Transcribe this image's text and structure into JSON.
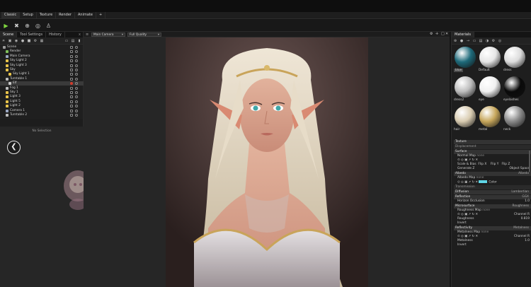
{
  "menubar": {
    "tabs": [
      "Classic",
      "Setup",
      "Texture",
      "Render",
      "Animate",
      "+"
    ]
  },
  "toolbar": {
    "tools": [
      "arrow-select-icon",
      "transform-icon",
      "globe-icon",
      "target-icon",
      "person-icon"
    ]
  },
  "left_panel": {
    "tabs": [
      "Scene",
      "Tool Settings",
      "History"
    ],
    "close": "x",
    "tree": [
      {
        "label": "Scene",
        "indent": 0,
        "color": "#9a9a9a"
      },
      {
        "label": "Render",
        "indent": 1,
        "color": "#7fc15a"
      },
      {
        "label": "Main Camera",
        "indent": 1,
        "color": "#9aa7c2"
      },
      {
        "label": "Sky Light 2",
        "indent": 1,
        "color": "#e8c34a"
      },
      {
        "label": "Sky Light 3",
        "indent": 1,
        "color": "#e8c34a"
      },
      {
        "label": "Sky",
        "indent": 1,
        "color": "#e8c34a"
      },
      {
        "label": "Sky Light 1",
        "indent": 2,
        "color": "#e8c34a"
      },
      {
        "label": "Turntable 1",
        "indent": 1,
        "color": "#bdbdbd"
      },
      {
        "label": "Elf",
        "indent": 2,
        "color": "#c9c9c9"
      },
      {
        "label": "Fog 1",
        "indent": 1,
        "color": "#bdbdbd"
      },
      {
        "label": "Sky 1",
        "indent": 1,
        "color": "#e8c34a"
      },
      {
        "label": "Light 3",
        "indent": 1,
        "color": "#e8c34a"
      },
      {
        "label": "Light 5",
        "indent": 1,
        "color": "#e8c34a"
      },
      {
        "label": "Light 2",
        "indent": 1,
        "color": "#e8c34a"
      },
      {
        "label": "Camera 1",
        "indent": 1,
        "color": "#9aa7c2"
      },
      {
        "label": "Turntable 2",
        "indent": 1,
        "color": "#bdbdbd"
      }
    ],
    "no_selection": "No Selection"
  },
  "viewport": {
    "camera_select": "Main Camera",
    "quality_select": "Full Quality"
  },
  "materials": {
    "title": "Materials",
    "items": [
      {
        "name": "blue",
        "color": "#1e6a7a",
        "selected": true
      },
      {
        "name": "Default",
        "color": "#e6e6e6",
        "selected": false
      },
      {
        "name": "dress",
        "color": "#dcdcdc",
        "selected": false
      },
      {
        "name": "dress2",
        "color": "#bdbdbd",
        "selected": false
      },
      {
        "name": "eye",
        "color": "#f0f0f0",
        "selected": false
      },
      {
        "name": "eyelashes",
        "color": "#0a0a0a",
        "selected": false
      },
      {
        "name": "hair",
        "color": "#d9ccb1",
        "selected": false
      },
      {
        "name": "metal",
        "color": "#c7a75c",
        "selected": false
      },
      {
        "name": "neck",
        "color": "#8a8a8a",
        "selected": false
      }
    ],
    "sections": {
      "texture": "Texture",
      "displacement": "Displacement",
      "surface": "Surface",
      "normal_map": "Normal Map",
      "normal_map_value": "none",
      "scale_bias": "Scale & Bias",
      "flip_x": "Flip X",
      "flip_y": "Flip Y",
      "flip_z": "Flip Z",
      "generate_z": "Generate Z",
      "object_space": "Object Space",
      "albedo": "Albedo",
      "albedo_value": "Albedo",
      "albedo_map": "Albedo Map",
      "albedo_map_value": "none",
      "color_label": "Color",
      "albedo_color": "#5fd5e6",
      "transmission": "Transmission",
      "diffusion": "Diffusion",
      "diffusion_value": "Lambertian",
      "reflection": "Reflection",
      "reflection_value": "GGX",
      "horizon": "Horizon Occlusion",
      "horizon_value": "1.0",
      "microsurface": "Microsurface",
      "microsurface_value": "Roughness",
      "roughness_map": "Roughness Map",
      "roughness_map_value": "none",
      "channel": "Channel",
      "channel_value": "R",
      "roughness": "Roughness",
      "roughness_value": "0.819",
      "invert": "Invert",
      "reflectivity": "Reflectivity",
      "reflectivity_value": "Metalness",
      "metalness_map": "Metalness Map",
      "metalness_map_value": "none",
      "channel2_value": "R",
      "metalness": "Metalness",
      "metalness_value": "1.0",
      "invert2": "Invert"
    }
  }
}
